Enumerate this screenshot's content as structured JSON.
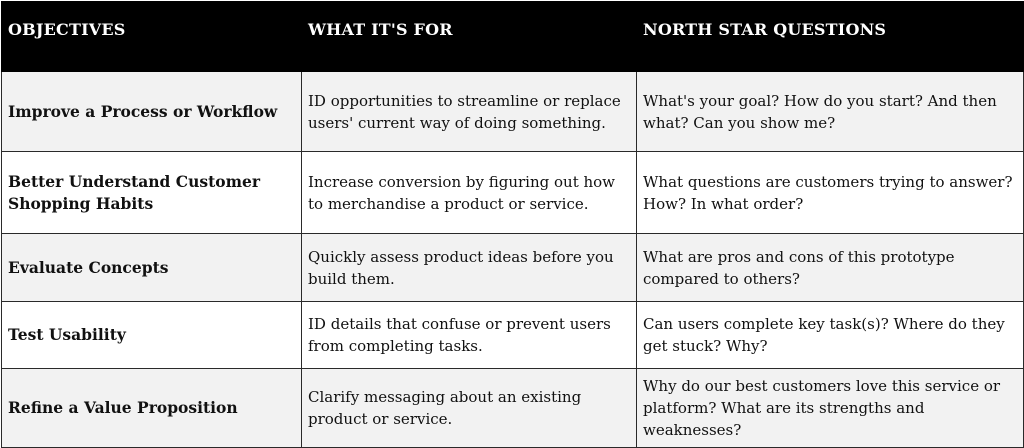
{
  "table": {
    "headers": [
      "OBJECTIVES",
      "WHAT IT'S FOR",
      "NORTH STAR QUESTIONS"
    ],
    "rows": [
      {
        "objective": "Improve a Process or Workflow",
        "purpose": "ID opportunities to streamline or replace users' current way of doing something.",
        "questions": "What's your goal? How do you start? And then what? Can you show me?"
      },
      {
        "objective": "Better Understand Customer Shopping Habits",
        "purpose": "Increase conversion by figuring out how to merchandise a product or service.",
        "questions": "What questions are customers trying to answer? How? In what order?"
      },
      {
        "objective": "Evaluate Concepts",
        "purpose": "Quickly assess product ideas before you build them.",
        "questions": "What are pros and cons of this prototype compared to others?"
      },
      {
        "objective": "Test Usability",
        "purpose": "ID details that confuse or prevent users from completing tasks.",
        "questions": "Can users complete key task(s)? Where do they get stuck? Why?"
      },
      {
        "objective": "Refine a Value Proposition",
        "purpose": "Clarify messaging about an existing product or service.",
        "questions": "Why do our best customers love this service or platform? What are its strengths and weaknesses?"
      }
    ]
  }
}
